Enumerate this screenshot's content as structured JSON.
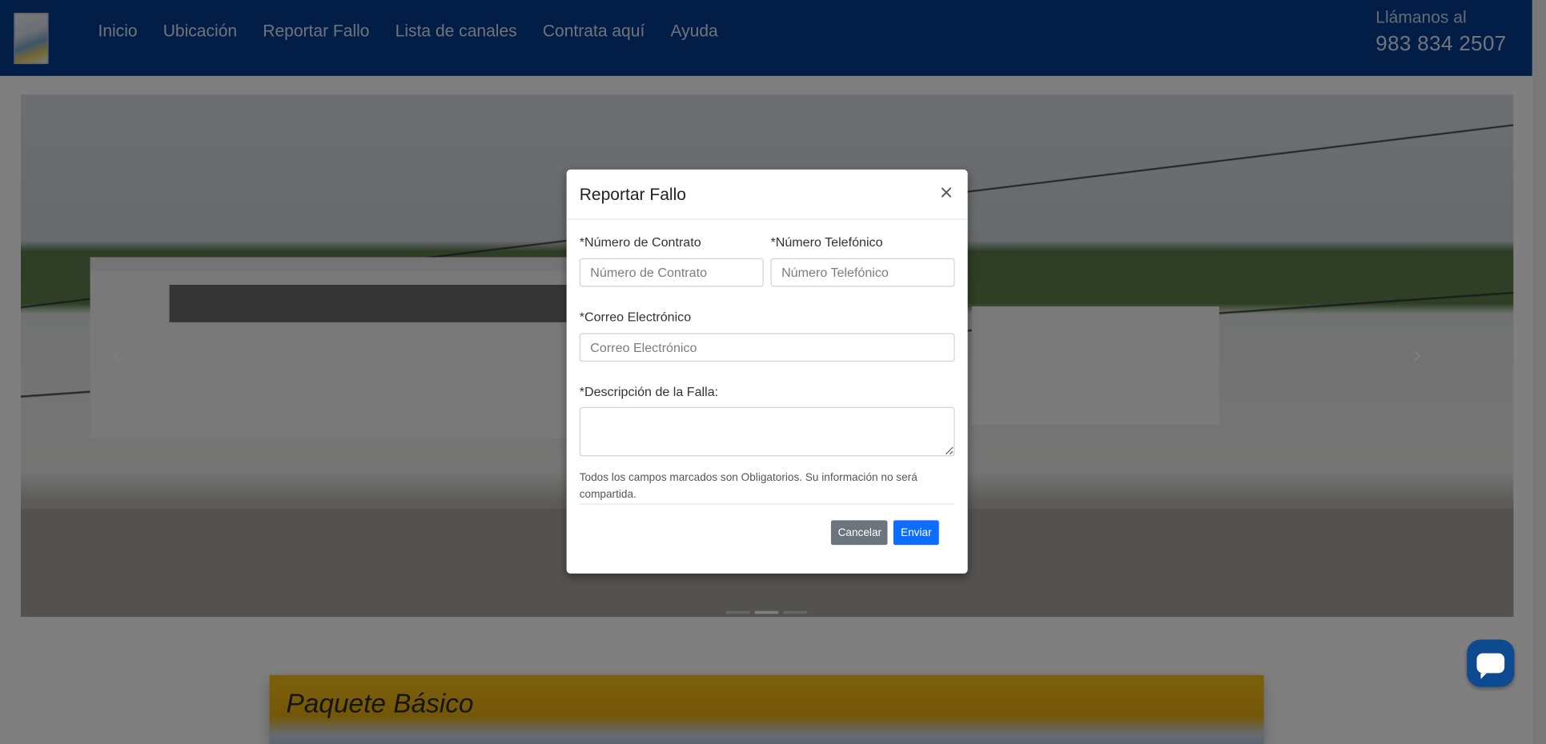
{
  "navbar": {
    "items": [
      "Inicio",
      "Ubicación",
      "Reportar Fallo",
      "Lista de canales",
      "Contrata aquí",
      "Ayuda"
    ],
    "call_label": "Llámanos al",
    "call_number": "983 834 2507",
    "background_color": "#053d8e"
  },
  "carousel": {
    "prev_icon": "chevron-left-icon",
    "next_icon": "chevron-right-icon",
    "prev_glyph": "‹",
    "next_glyph": "›",
    "indicators": 3,
    "active_index": 1
  },
  "package": {
    "title": "Paquete Básico",
    "color": "#f6c21a"
  },
  "chat": {
    "icon": "chat-bubble-icon"
  },
  "modal": {
    "title": "Reportar Fallo",
    "close_glyph": "×",
    "contract_label": "*Número de Contrato",
    "contract_placeholder": "Número de Contrato",
    "phone_label": "*Número Telefónico",
    "phone_placeholder": "Número Telefónico",
    "email_label": "*Correo Electrónico",
    "email_placeholder": "Correo Electrónico",
    "description_label": "*Descripción de la Falla:",
    "note": "Todos los campos marcados son Obligatorios. Su información no será compartida.",
    "cancel_label": "Cancelar",
    "send_label": "Enviar",
    "send_color": "#0d6efd",
    "cancel_color": "#6c757d"
  }
}
